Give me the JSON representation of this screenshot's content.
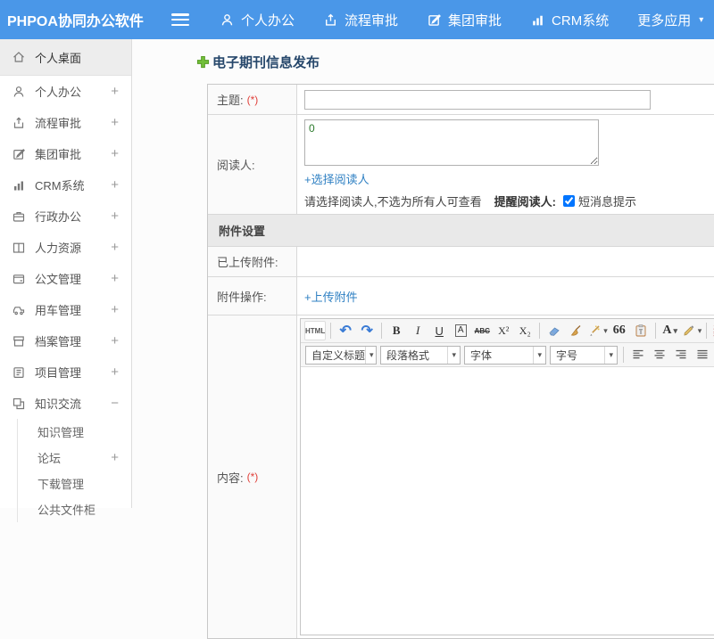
{
  "topbar": {
    "app_title": "PHPOA协同办公软件",
    "nav": [
      {
        "label": "个人办公"
      },
      {
        "label": "流程审批"
      },
      {
        "label": "集团审批"
      },
      {
        "label": "CRM系统"
      },
      {
        "label": "更多应用"
      }
    ]
  },
  "icons": {
    "caret_down": "▾",
    "undo": "↶",
    "redo": "↷"
  },
  "sidebar": {
    "items": [
      {
        "label": "个人桌面",
        "expand": ""
      },
      {
        "label": "个人办公",
        "expand": "+"
      },
      {
        "label": "流程审批",
        "expand": "+"
      },
      {
        "label": "集团审批",
        "expand": "+"
      },
      {
        "label": "CRM系统",
        "expand": "+"
      },
      {
        "label": "行政办公",
        "expand": "+"
      },
      {
        "label": "人力资源",
        "expand": "+"
      },
      {
        "label": "公文管理",
        "expand": "+"
      },
      {
        "label": "用车管理",
        "expand": "+"
      },
      {
        "label": "档案管理",
        "expand": "+"
      },
      {
        "label": "项目管理",
        "expand": "+"
      },
      {
        "label": "知识交流",
        "expand": "−"
      }
    ],
    "subitems": [
      {
        "label": "知识管理",
        "expand": ""
      },
      {
        "label": "论坛",
        "expand": "+"
      },
      {
        "label": "下载管理",
        "expand": ""
      },
      {
        "label": "公共文件柜",
        "expand": ""
      }
    ]
  },
  "main": {
    "page_title": "电子期刊信息发布",
    "form": {
      "subject_label": "主题:",
      "required_mark": "(*)",
      "readers_label": "阅读人:",
      "readers_value": "0",
      "choose_readers_link": "+选择阅读人",
      "readers_hint": "请选择阅读人,不选为所有人可查看",
      "remind_label": "提醒阅读人:",
      "sms_label": "短消息提示",
      "attachment_section_title": "附件设置",
      "uploaded_label": "已上传附件:",
      "operation_label": "附件操作:",
      "upload_link": "+上传附件",
      "content_label": "内容:"
    },
    "editor": {
      "html_button": "HTML",
      "bold": "B",
      "italic": "I",
      "underline": "U",
      "char_border": "A",
      "strike": "ABC",
      "superscript": "X²",
      "subscript": "X₂",
      "quote": "66",
      "font_color": "A",
      "heading_select": "自定义标题",
      "paragraph_select": "段落格式",
      "font_select": "字体",
      "size_select": "字号"
    }
  }
}
